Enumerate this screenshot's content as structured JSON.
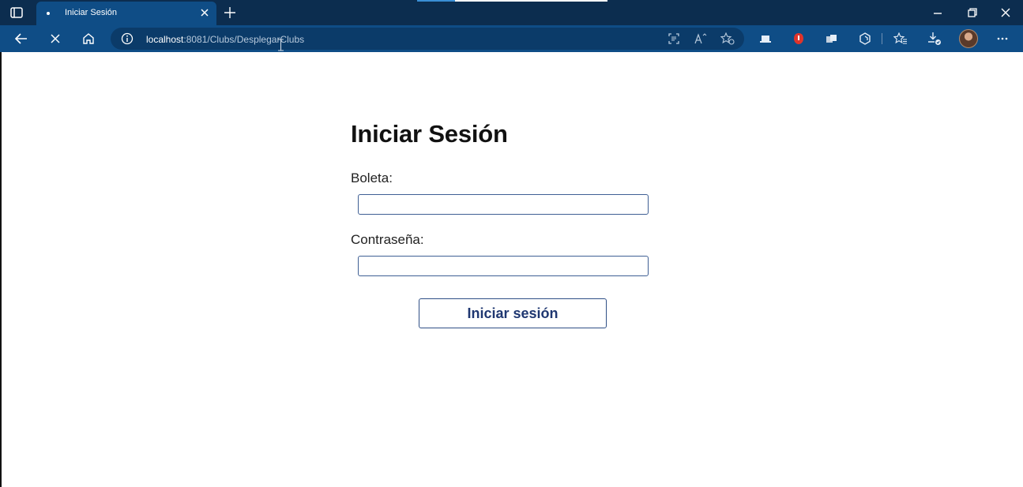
{
  "browser": {
    "tab_title": "Iniciar Sesión",
    "address": {
      "host": "localhost",
      "path": ":8081/Clubs/DesplegarClubs"
    }
  },
  "login": {
    "title": "Iniciar Sesión",
    "boleta_label": "Boleta:",
    "boleta_value": "",
    "password_label": "Contraseña:",
    "password_value": "",
    "submit_label": "Iniciar sesión"
  },
  "icons": [
    "tab-actions-icon",
    "loading-dot-icon",
    "close-icon",
    "plus-icon",
    "minimize-icon",
    "restore-icon",
    "back-arrow-icon",
    "stop-icon",
    "home-icon",
    "info-icon",
    "immersive-reader-icon",
    "read-aloud-icon",
    "add-favorite-icon",
    "extension-icon",
    "favorites-icon",
    "collections-icon",
    "downloads-icon",
    "more-icon"
  ],
  "colors": {
    "titlebar": "#0c2d4f",
    "navbar": "#0f4d86",
    "address_bar": "#0b3b69",
    "button_text": "#1f3771",
    "input_border": "#3f5f94"
  }
}
